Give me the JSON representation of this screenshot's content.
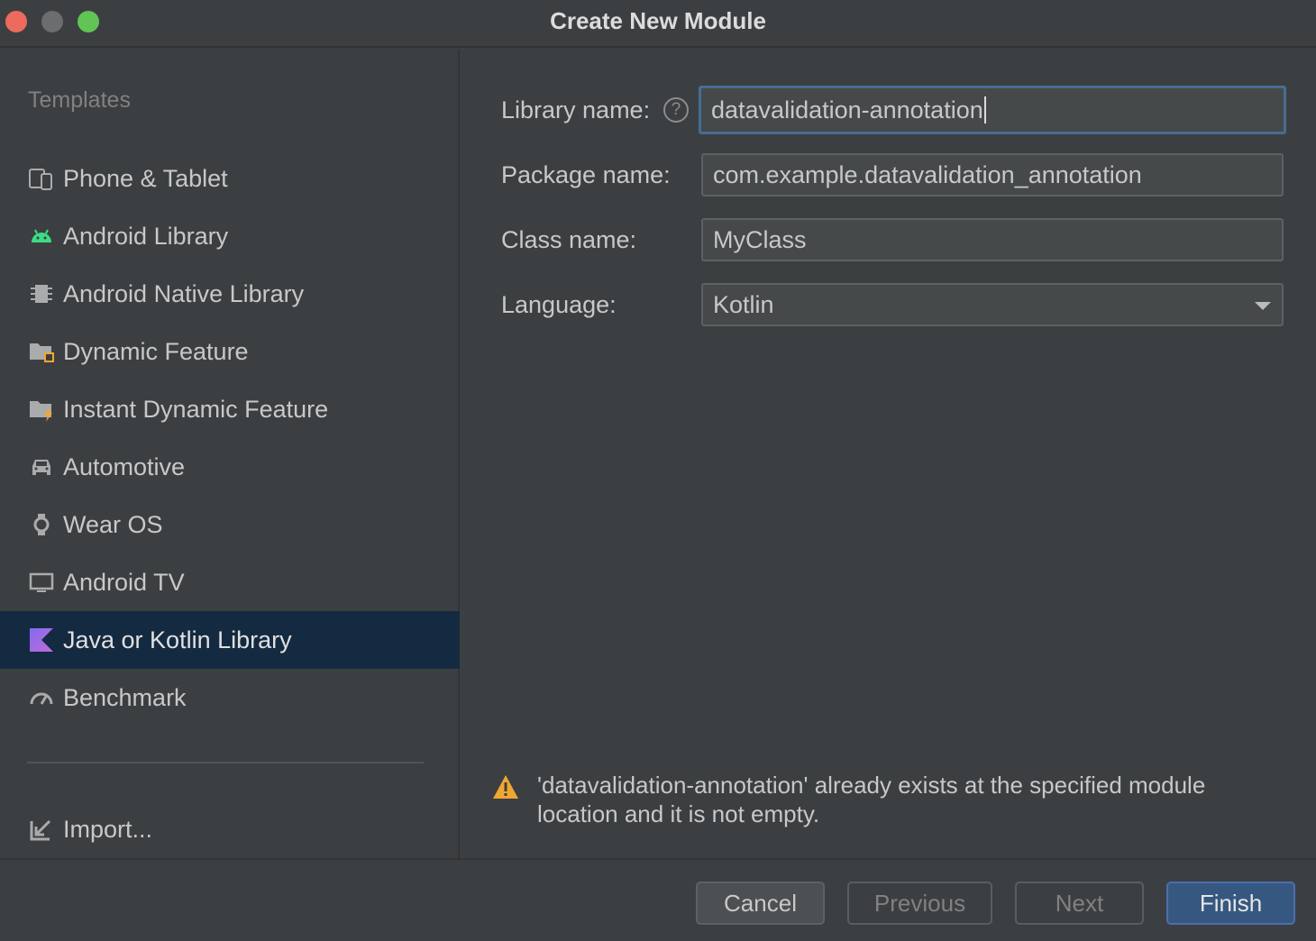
{
  "window": {
    "title": "Create New Module"
  },
  "sidebar": {
    "heading": "Templates",
    "items": [
      {
        "label": "Phone & Tablet",
        "icon": "phone-tablet-icon"
      },
      {
        "label": "Android Library",
        "icon": "android-icon"
      },
      {
        "label": "Android Native Library",
        "icon": "native-library-icon"
      },
      {
        "label": "Dynamic Feature",
        "icon": "dynamic-feature-icon"
      },
      {
        "label": "Instant Dynamic Feature",
        "icon": "instant-feature-icon"
      },
      {
        "label": "Automotive",
        "icon": "car-icon"
      },
      {
        "label": "Wear OS",
        "icon": "watch-icon"
      },
      {
        "label": "Android TV",
        "icon": "tv-icon"
      },
      {
        "label": "Java or Kotlin Library",
        "icon": "kotlin-icon",
        "selected": true
      },
      {
        "label": "Benchmark",
        "icon": "gauge-icon"
      }
    ],
    "import_label": "Import..."
  },
  "form": {
    "library_name": {
      "label": "Library name:",
      "value": "datavalidation-annotation"
    },
    "package_name": {
      "label": "Package name:",
      "value": "com.example.datavalidation_annotation"
    },
    "class_name": {
      "label": "Class name:",
      "value": "MyClass"
    },
    "language": {
      "label": "Language:",
      "value": "Kotlin"
    },
    "help_glyph": "?"
  },
  "warning": {
    "text": "'datavalidation-annotation' already exists at the specified module location and it is not empty."
  },
  "buttons": {
    "cancel": "Cancel",
    "previous": "Previous",
    "next": "Next",
    "finish": "Finish"
  },
  "colors": {
    "background": "#3c3f41",
    "selection": "#142a41",
    "primary_button": "#365880",
    "warning": "#f0a732",
    "android_green": "#3ddc84"
  }
}
